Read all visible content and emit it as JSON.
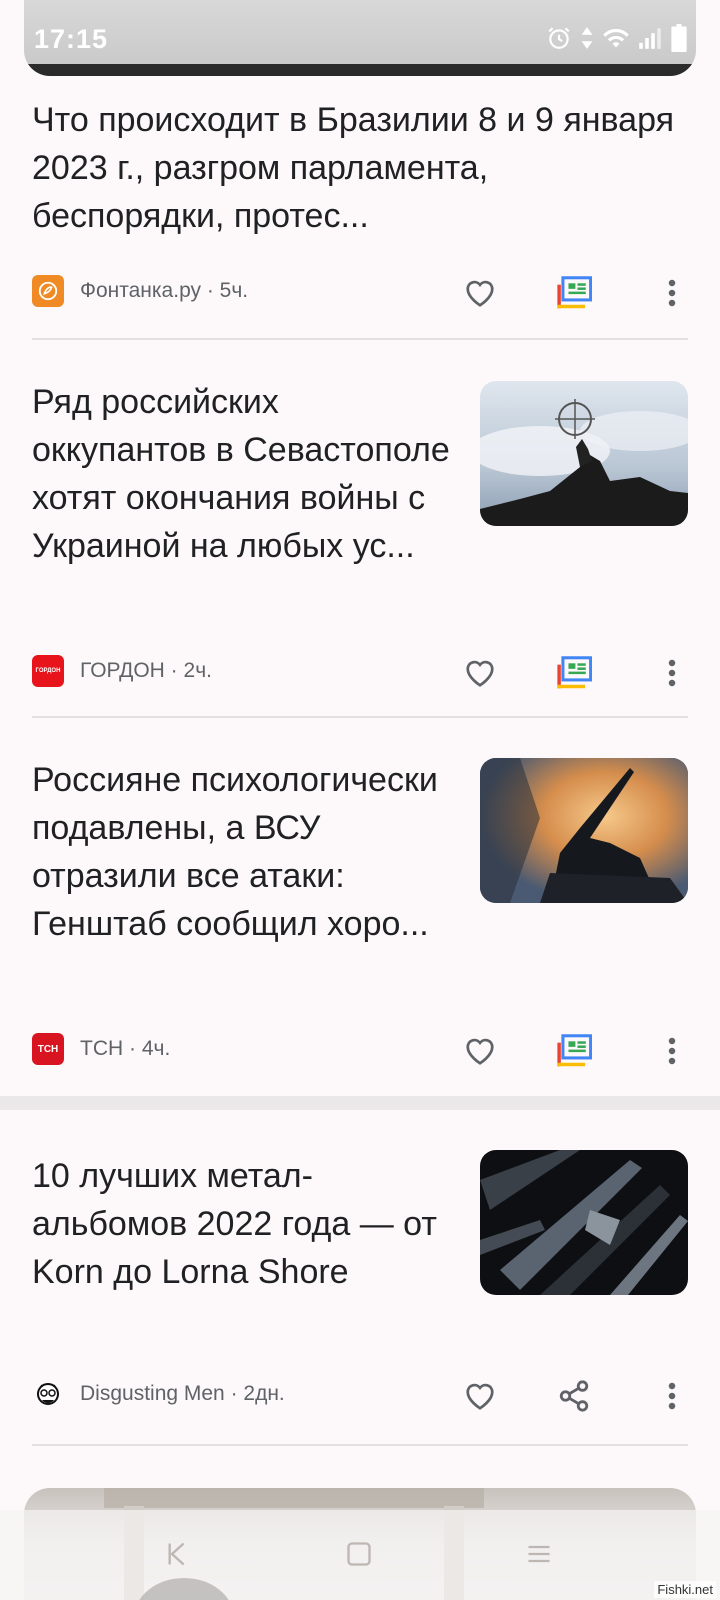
{
  "status_bar": {
    "time": "17:15"
  },
  "articles": [
    {
      "title": "Что происходит в Бразилии 8 и 9 января 2023 г., разгром парламента, беспорядки, протес...",
      "source": "Фонтанка.ру",
      "age": "5ч.",
      "meta": "Фонтанка.ру · 5ч.",
      "logo_color": "#f08a24"
    },
    {
      "title": "Ряд российских оккупантов в Севастополе хотят окончания войны с Украиной на любых ус...",
      "source": "ГОРДОН",
      "age": "2ч.",
      "meta": "ГОРДОН · 2ч.",
      "logo_text": "ГОРДОН",
      "logo_color": "#e8141b"
    },
    {
      "title": "Россияне психологически подавлены, а ВСУ отразили все атаки: Генштаб сообщил хоро...",
      "source": "ТСН",
      "age": "4ч.",
      "meta": "ТСН · 4ч.",
      "logo_text": "ТСН",
      "logo_color": "#d7141f"
    },
    {
      "title": "10 лучших метал-альбомов 2022 года — от Korn до Lorna Shore",
      "source": "Disgusting Men",
      "age": "2дн.",
      "meta": "Disgusting Men · 2дн."
    }
  ],
  "watermark": "Fishki.net",
  "icons": {
    "heart": "heart-icon",
    "full_coverage": "full-coverage-icon",
    "more": "more-vert-icon",
    "share": "share-icon"
  }
}
